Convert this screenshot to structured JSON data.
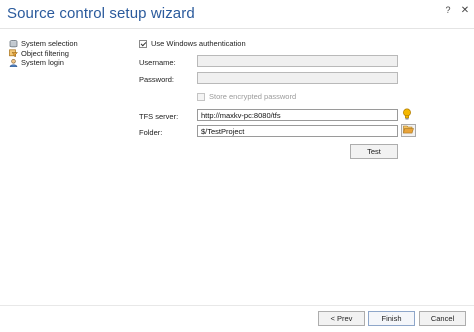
{
  "window": {
    "title": "Source control setup wizard",
    "help_glyph": "?",
    "close_glyph": "✕"
  },
  "nav": {
    "items": [
      {
        "label": "System selection",
        "icon": "database-icon"
      },
      {
        "label": "Object filtering",
        "icon": "filter-icon"
      },
      {
        "label": "System login",
        "icon": "user-icon"
      }
    ]
  },
  "form": {
    "windows_auth": {
      "label": "Use Windows authentication",
      "checked": true
    },
    "username": {
      "label": "Username:",
      "value": ""
    },
    "password": {
      "label": "Password:",
      "value": ""
    },
    "store_password": {
      "label": "Store encrypted password",
      "checked": false,
      "enabled": false
    },
    "tfs_server": {
      "label": "TFS server:",
      "value": "http://maxkv-pc:8080/tfs"
    },
    "folder": {
      "label": "Folder:",
      "value": "$/TestProject"
    },
    "test_button": "Test"
  },
  "footer": {
    "prev": "< Prev",
    "finish": "Finish",
    "cancel": "Cancel"
  },
  "colors": {
    "title": "#2a5a9c",
    "bulb": "#f5b800",
    "folder": "#e8a33a"
  }
}
